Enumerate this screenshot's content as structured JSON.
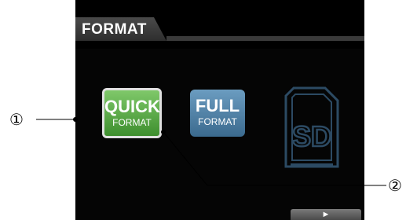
{
  "header": {
    "title": "FORMAT"
  },
  "buttons": {
    "quick": {
      "line1": "QUICK",
      "line2": "FORMAT",
      "state": "selected",
      "color": "#5aa844"
    },
    "full": {
      "line1": "FULL",
      "line2": "FORMAT",
      "color": "#4f82a8"
    }
  },
  "sd_card": {
    "label": "SD",
    "icon": "sd-card-icon"
  },
  "bottom_bar": {
    "play_label": "►"
  },
  "callouts": {
    "c1": "①",
    "c2": "②"
  },
  "colors": {
    "screen_bg": "#050505",
    "tab_bg": "#3a3a3a",
    "sd_outline": "#2c4a63"
  }
}
